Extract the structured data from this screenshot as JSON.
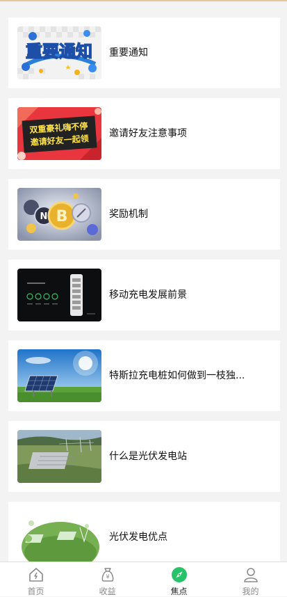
{
  "colors": {
    "accent_green": "#28c26b",
    "tab_inactive": "#8a8a8a",
    "tab_active": "#222222",
    "top_line": "#e6c79a"
  },
  "articles": [
    {
      "title": "重要通知",
      "thumb_text": "重要通知",
      "thumb_icon": "notice-banner"
    },
    {
      "title": "邀请好友注意事项",
      "thumb_text_1": "双重豪礼嗨不停",
      "thumb_text_2": "邀请好友一起领",
      "thumb_icon": "invite-banner"
    },
    {
      "title": "奖励机制",
      "thumb_icon": "coins-image"
    },
    {
      "title": "移动充电发展前景",
      "thumb_icon": "charger-image"
    },
    {
      "title": "特斯拉充电桩如何做到一枝独...",
      "thumb_icon": "solar-panel-image"
    },
    {
      "title": "什么是光伏发电站",
      "thumb_icon": "power-station-image"
    },
    {
      "title": "光伏发电优点",
      "thumb_icon": "solar-farm-image"
    }
  ],
  "tabbar": {
    "tabs": [
      {
        "label": "首页",
        "icon": "home-icon",
        "active": false
      },
      {
        "label": "收益",
        "icon": "money-bag-icon",
        "active": false
      },
      {
        "label": "焦点",
        "icon": "compass-icon",
        "active": true
      },
      {
        "label": "我的",
        "icon": "user-icon",
        "active": false
      }
    ]
  }
}
